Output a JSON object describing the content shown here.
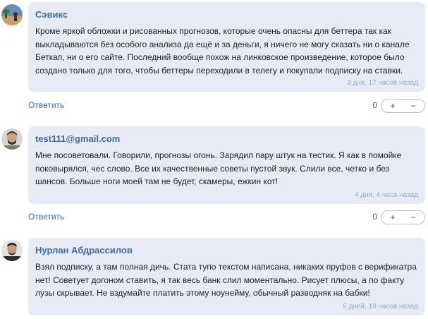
{
  "comments": [
    {
      "author": "Сэвикс",
      "text": "Кроме яркой обложки и рисованных прогнозов, которые очень опасны для беттера так как выкладываются без особого анализа да ещё и за деньги, я ничего не могу сказать ни о канале Беткап, ни о его сайте. Последний вообще похож на линковское произведение, которое было создано только для того, чтобы беттеры переходили в телегу и покупали подписку на ставки.",
      "time": "3 дня, 17 часов назад",
      "reply_label": "Ответить",
      "score": "0",
      "plus_label": "+",
      "minus_label": "−"
    },
    {
      "author": "test111@gmail.com",
      "text": "Мне посоветовали. Говорили, прогнозы огонь. Зарядил пару штук на тестик. Я как в помойке поковырялся, чес слово. Все их качественные советы пустой звук. Слили все, четко и без шансов. Больше ноги моей там не будет, скамеры, ежкин кот!",
      "time": "4 дня, 4 часа назад",
      "reply_label": "Ответить",
      "score": "0",
      "plus_label": "+",
      "minus_label": "−"
    },
    {
      "author": "Нурлан Абдрассилов",
      "text": "Взял подписку, а там полная дичь. Стата тупо текстом написана, никаких пруфов с верификатра нет! Советует догоном ставить, я так весь банк слил моментально. Рисует плюсы, а по факту лузы скрывает. Не вздумайте платить этому ноунейму, обычный разводняк на бабки!",
      "time": "5 дней, 10 часов назад"
    }
  ]
}
